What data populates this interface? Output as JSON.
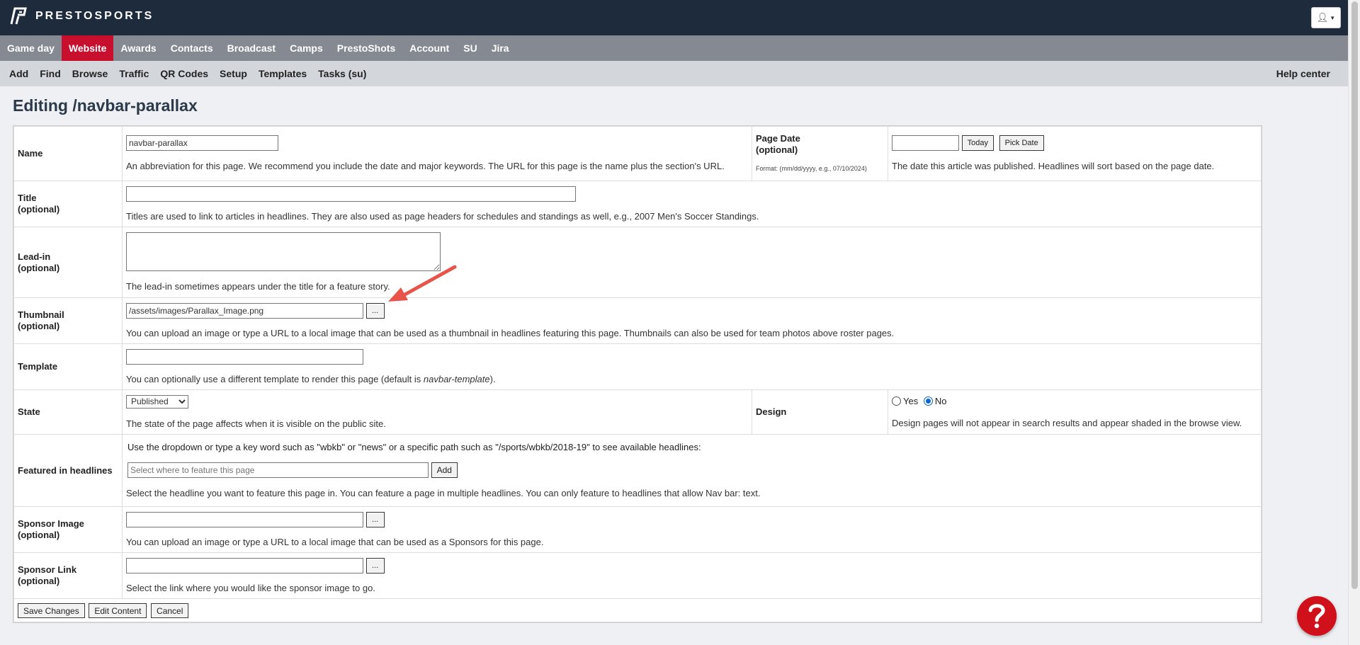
{
  "brand": {
    "name": "PRESTOSPORTS"
  },
  "header": {
    "user_menu_icon": "user-icon"
  },
  "main_nav": {
    "items": [
      "Game day",
      "Website",
      "Awards",
      "Contacts",
      "Broadcast",
      "Camps",
      "PrestoShots",
      "Account",
      "SU",
      "Jira"
    ],
    "active": "Website",
    "active_color": "#c8102e"
  },
  "sub_nav": {
    "items": [
      "Add",
      "Find",
      "Browse",
      "Traffic",
      "QR Codes",
      "Setup",
      "Templates",
      "Tasks (su)"
    ],
    "help": "Help center"
  },
  "page": {
    "title": "Editing /navbar-parallax"
  },
  "form": {
    "name": {
      "label": "Name",
      "value": "navbar-parallax",
      "help": "An abbreviation for this page. We recommend you include the date and major keywords. The URL for this page is the name plus the section's URL."
    },
    "page_date": {
      "label_line1": "Page Date",
      "label_line2": "(optional)",
      "format": "Format: (mm/dd/yyyy, e.g., 07/10/2024)",
      "value": "",
      "today_label": "Today",
      "pick_label": "Pick Date",
      "help": "The date this article was published. Headlines will sort based on the page date."
    },
    "title": {
      "label_line1": "Title",
      "label_line2": "(optional)",
      "value": "",
      "help": "Titles are used to link to articles in headlines. They are also used as page headers for schedules and standings as well, e.g., 2007 Men's Soccer Standings."
    },
    "lead_in": {
      "label_line1": "Lead-in",
      "label_line2": "(optional)",
      "value": "",
      "help": "The lead-in sometimes appears under the title for a feature story."
    },
    "thumbnail": {
      "label_line1": "Thumbnail",
      "label_line2": "(optional)",
      "value": "/assets/images/Parallax_Image.png",
      "browse_label": "...",
      "help": "You can upload an image or type a URL to a local image that can be used as a thumbnail in headlines featuring this page. Thumbnails can also be used for team photos above roster pages."
    },
    "template": {
      "label": "Template",
      "value": "",
      "help_prefix": "You can optionally use a different template to render this page (default is ",
      "help_default": "navbar-template",
      "help_suffix": ")."
    },
    "state": {
      "label": "State",
      "selected": "Published",
      "help": "The state of the page affects when it is visible on the public site."
    },
    "design": {
      "label": "Design",
      "yes_label": "Yes",
      "no_label": "No",
      "selected": "No",
      "help": "Design pages will not appear in search results and appear shaded in the browse view."
    },
    "featured": {
      "label": "Featured in headlines",
      "intro": "Use the dropdown or type a key word such as \"wbkb\" or \"news\" or a specific path such as \"/sports/wbkb/2018-19\" to see available headlines:",
      "placeholder": "Select where to feature this page",
      "add_label": "Add",
      "help": "Select the headline you want to feature this page in. You can feature a page in multiple headlines. You can only feature to headlines that allow Nav bar: text."
    },
    "sponsor_image": {
      "label_line1": "Sponsor Image",
      "label_line2": "(optional)",
      "value": "",
      "browse_label": "...",
      "help": "You can upload an image or type a URL to a local image that can be used as a Sponsors for this page."
    },
    "sponsor_link": {
      "label_line1": "Sponsor Link",
      "label_line2": "(optional)",
      "value": "",
      "browse_label": "...",
      "help": "Select the link where you would like the sponsor image to go."
    }
  },
  "actions": {
    "save": "Save Changes",
    "edit_content": "Edit Content",
    "cancel": "Cancel"
  },
  "help_fab": {
    "icon": "question-icon",
    "color": "#d0101a"
  }
}
